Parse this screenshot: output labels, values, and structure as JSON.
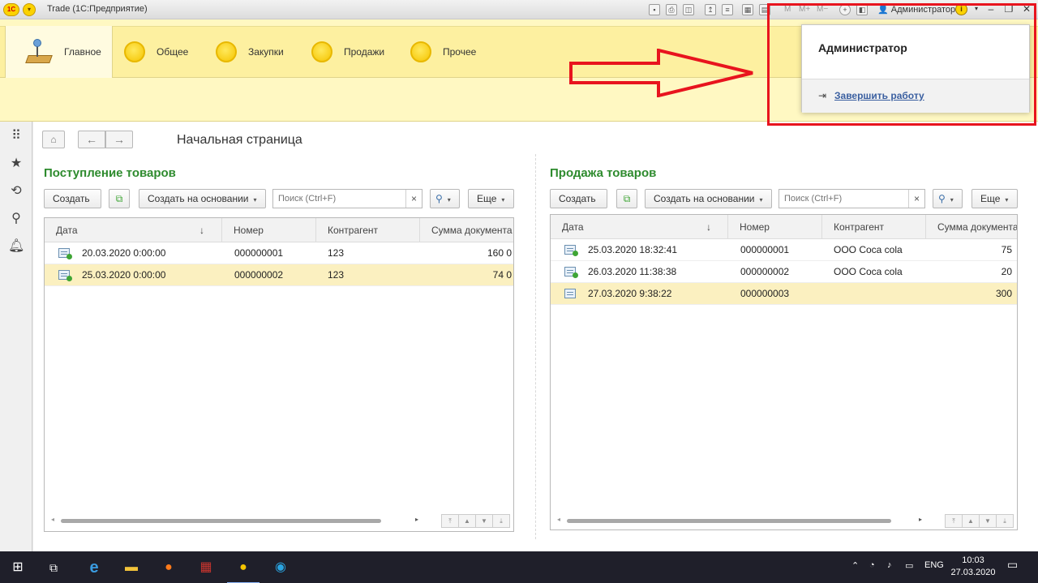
{
  "window": {
    "title": "Trade  (1С:Предприятие)",
    "logo_text": "1С",
    "toolbar_labels": [
      "M",
      "M+",
      "M−"
    ],
    "user": "Администратор"
  },
  "sections": [
    {
      "label": "Главное",
      "active": true
    },
    {
      "label": "Общее",
      "active": false
    },
    {
      "label": "Закупки",
      "active": false
    },
    {
      "label": "Продажи",
      "active": false
    },
    {
      "label": "Прочее",
      "active": false
    }
  ],
  "sidebar_icons": [
    "apps-grid-icon",
    "favorites-star-icon",
    "history-icon",
    "search-icon",
    "notifications-bell-icon"
  ],
  "page": {
    "title": "Начальная страница"
  },
  "left_panel": {
    "title": "Поступление товаров",
    "btn_create": "Создать",
    "btn_create_based": "Создать на основании",
    "search_placeholder": "Поиск (Ctrl+F)",
    "btn_more": "Еще",
    "columns": [
      "Дата",
      "Номер",
      "Контрагент",
      "Сумма документа"
    ],
    "sort_indicator": "↓",
    "rows": [
      {
        "date": "20.03.2020 0:00:00",
        "number": "000000001",
        "counterparty": "123",
        "sum": "160 0",
        "selected": false,
        "posted": true
      },
      {
        "date": "25.03.2020 0:00:00",
        "number": "000000002",
        "counterparty": "123",
        "sum": "74 0",
        "selected": true,
        "posted": true
      }
    ]
  },
  "right_panel": {
    "title": "Продажа товаров",
    "btn_create": "Создать",
    "btn_create_based": "Создать на основании",
    "search_placeholder": "Поиск (Ctrl+F)",
    "btn_more": "Еще",
    "columns": [
      "Дата",
      "Номер",
      "Контрагент",
      "Сумма документа"
    ],
    "sort_indicator": "↓",
    "rows": [
      {
        "date": "25.03.2020 18:32:41",
        "number": "000000001",
        "counterparty": "ООО Coca cola",
        "sum": "75",
        "selected": false,
        "posted": true
      },
      {
        "date": "26.03.2020 11:38:38",
        "number": "000000002",
        "counterparty": "ООО Coca cola",
        "sum": "20",
        "selected": false,
        "posted": true
      },
      {
        "date": "27.03.2020 9:38:22",
        "number": "000000003",
        "counterparty": "",
        "sum": "300",
        "selected": true,
        "posted": false
      }
    ]
  },
  "popup": {
    "user": "Администратор",
    "exit_label": "Завершить работу"
  },
  "taskbar": {
    "lang": "ENG",
    "time": "10:03",
    "date": "27.03.2020"
  },
  "colors": {
    "accent_green": "#2e8b2e",
    "section_yellow": "#fdf0a0",
    "selected_row": "#fbf0c0",
    "annotation_red": "#e8141e"
  }
}
